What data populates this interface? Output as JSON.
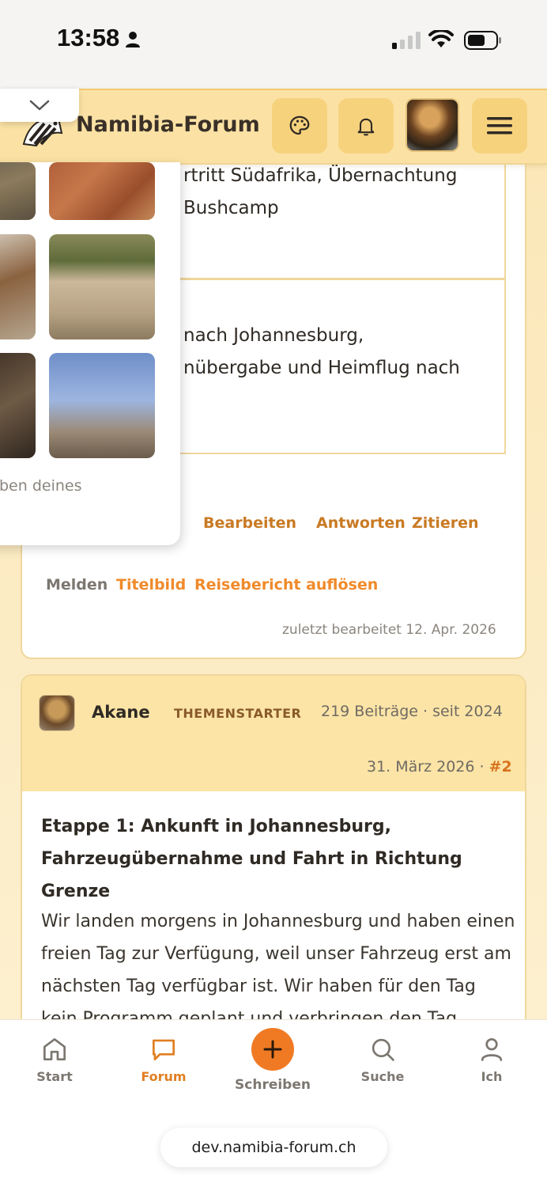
{
  "status_bar": {
    "time": "13:58"
  },
  "header": {
    "site_title": "Namibia-Forum",
    "icons": [
      "palette-icon",
      "bell-icon",
      "menu-icon"
    ]
  },
  "post1": {
    "stage_text_1": [
      "rtritt Südafrika, Übernachtung",
      "Bushcamp"
    ],
    "stage_text_2": [
      "nach Johannesburg,",
      "nübergabe und Heimflug nach"
    ],
    "actions": {
      "edit": "Bearbeiten",
      "reply": "Antworten",
      "quote": "Zitieren",
      "report": "Melden",
      "cover_image": "Titelbild",
      "dissolve_report": "Reisebericht auflösen"
    },
    "edited_note": "zuletzt bearbeitet 12. Apr. 2026"
  },
  "photo_popup": {
    "caption": "staben deines"
  },
  "post2": {
    "author": "Akane",
    "badge": "THEMENSTARTER",
    "meta": "219 Beiträge · seit 2024",
    "date": "31. März 2026 ·",
    "number": "#2",
    "title": "Etappe 1: Ankunft in Johannesburg, Fahrzeugübernahme und Fahrt in Richtung Grenze",
    "body": "Wir landen morgens in Johannesburg und haben einen freien Tag zur Verfügung, weil unser Fahrzeug erst am nächsten Tag verfügbar ist. Wir haben für den Tag kein Programm geplant und verbringen den Tag"
  },
  "tabbar": {
    "start": "Start",
    "forum": "Forum",
    "write": "Schreiben",
    "search": "Suche",
    "me": "Ich",
    "active_color": "#e07f22"
  },
  "browser": {
    "url": "dev.namibia-forum.ch"
  },
  "colors": {
    "accent": "#f07a24",
    "header_bg": "#fbe2a4",
    "link": "#c97a23"
  }
}
